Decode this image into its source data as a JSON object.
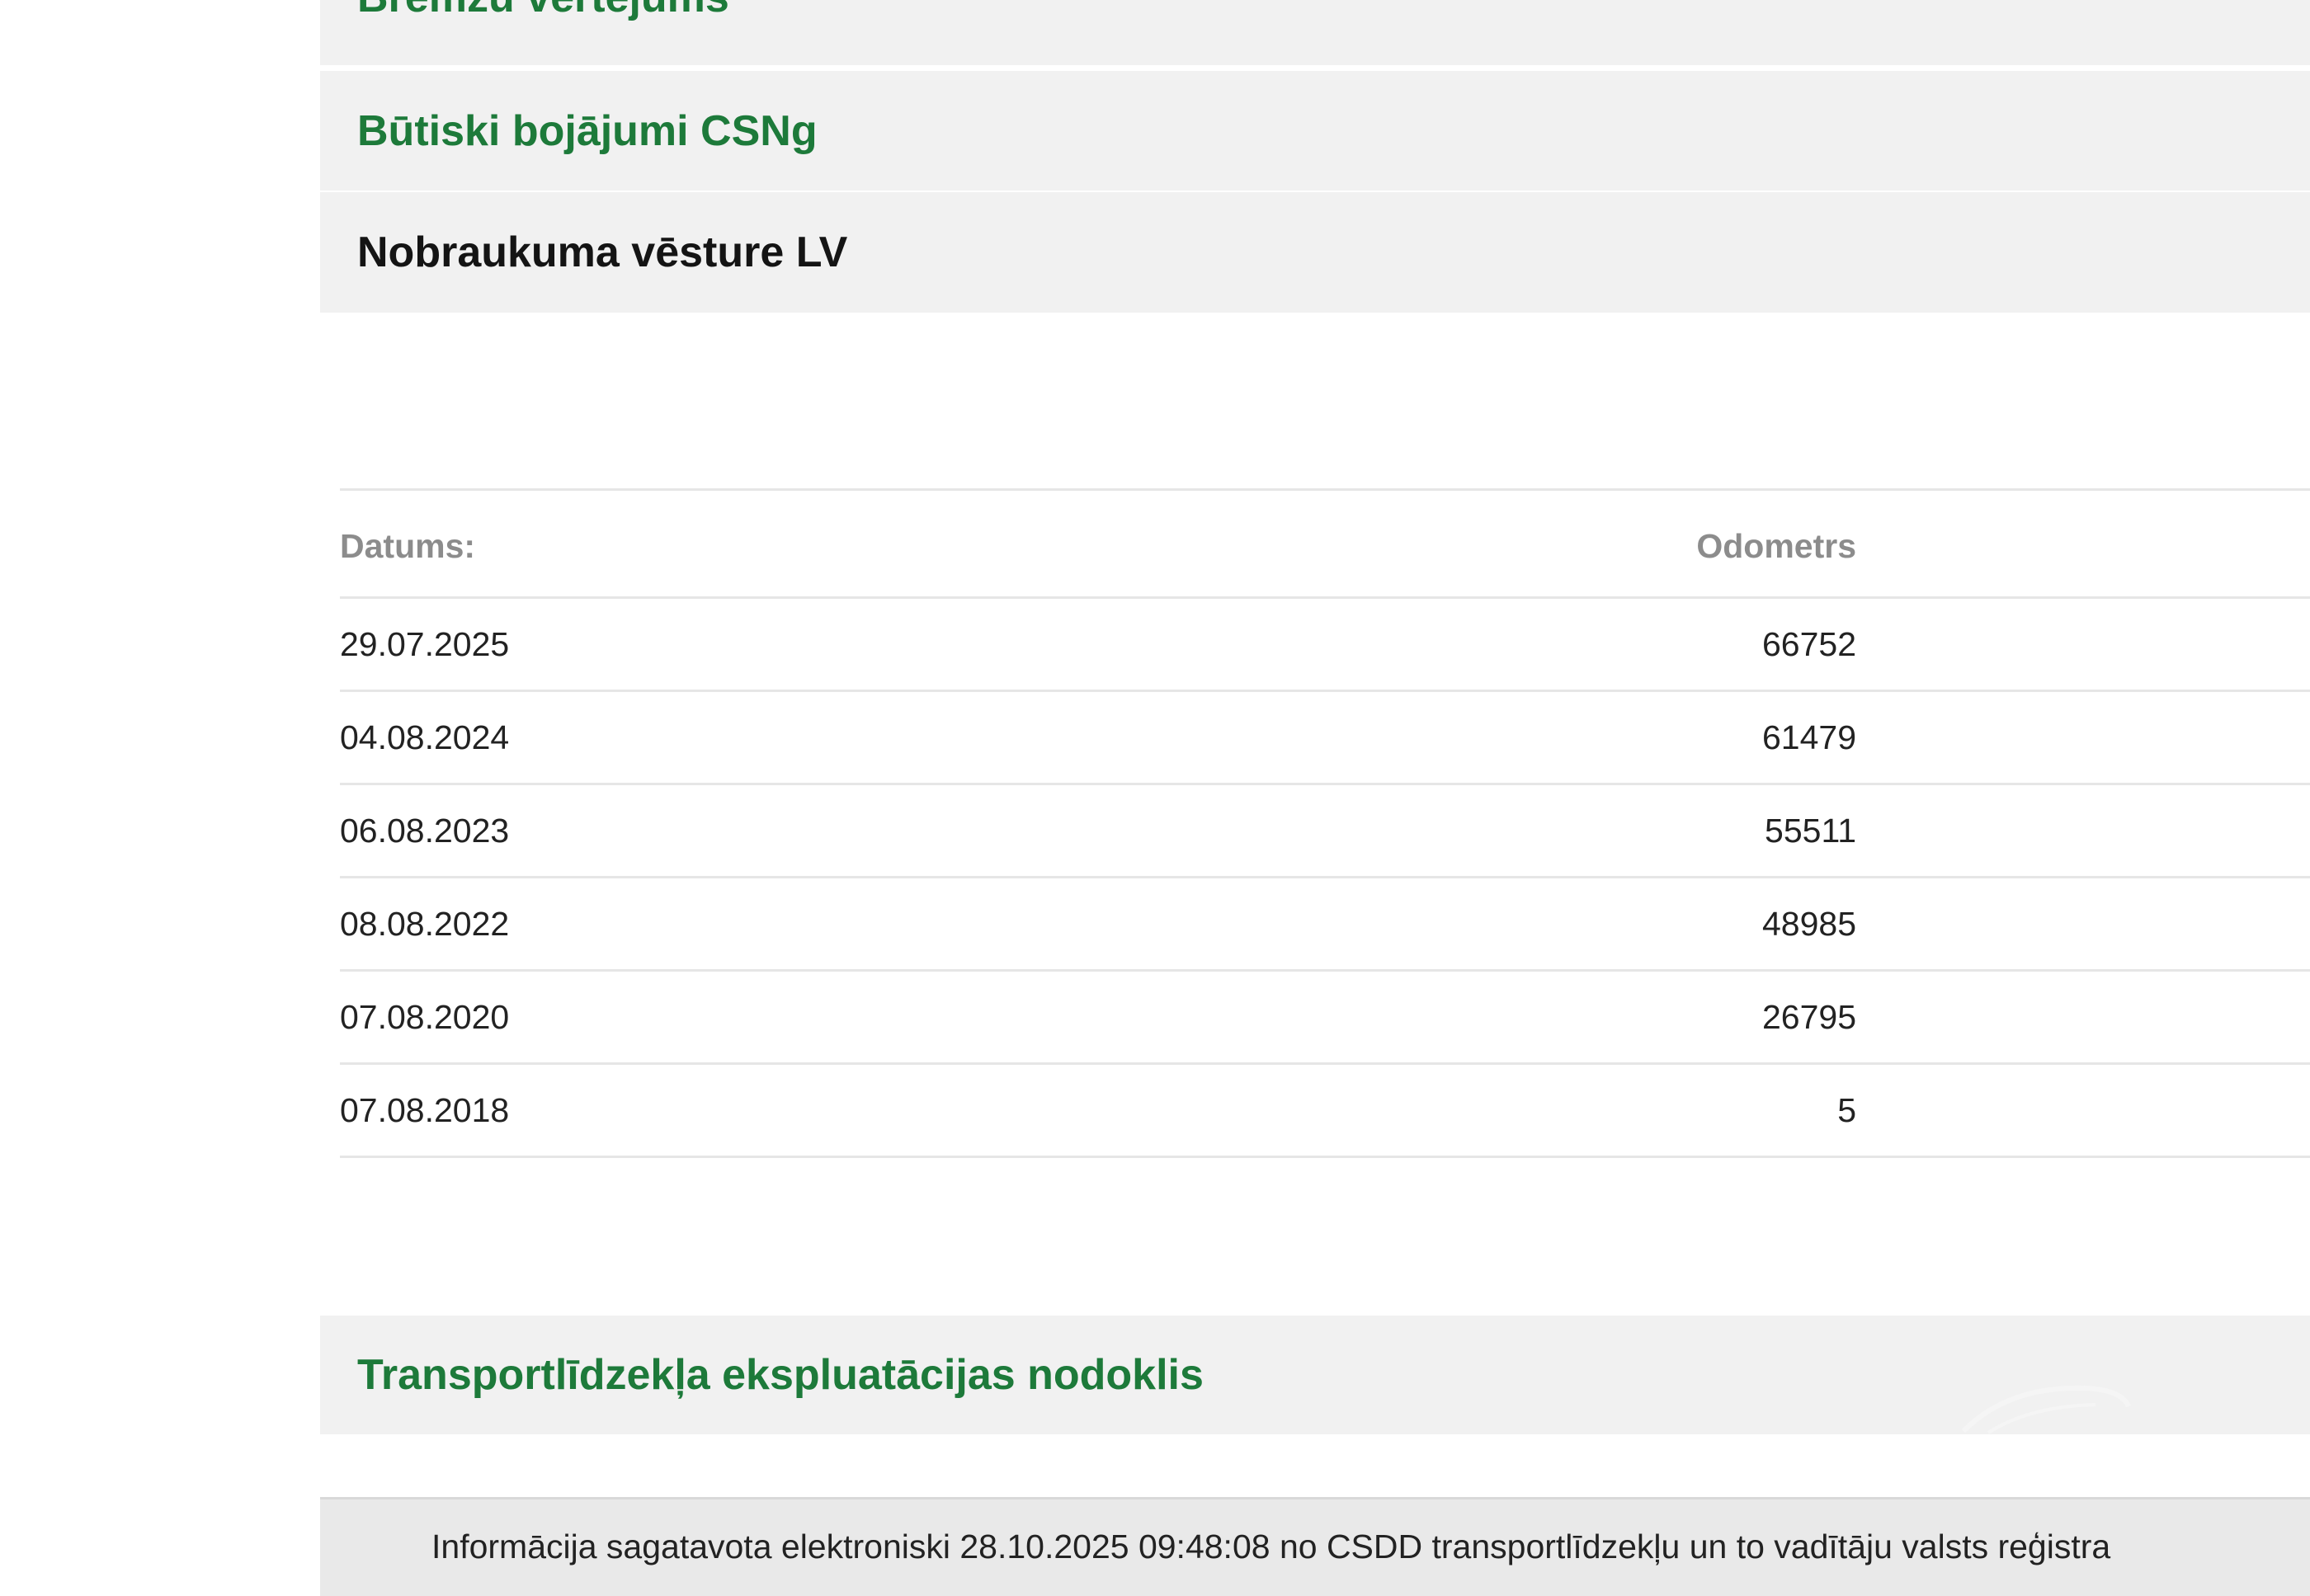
{
  "sections": {
    "bremzu": {
      "label": "Bremzu vērtējums"
    },
    "butiski": {
      "label": "Būtiski bojājumi CSNg"
    },
    "nobraukuma": {
      "label": "Nobraukuma vēsture LV"
    },
    "nodoklis": {
      "label": "Transportlīdzekļa ekspluatācijas nodoklis"
    }
  },
  "mileage_table": {
    "headers": {
      "date": "Datums:",
      "odometer": "Odometrs"
    },
    "rows": [
      {
        "date": "29.07.2025",
        "odometer": "66752"
      },
      {
        "date": "04.08.2024",
        "odometer": "61479"
      },
      {
        "date": "06.08.2023",
        "odometer": "55511"
      },
      {
        "date": "08.08.2022",
        "odometer": "48985"
      },
      {
        "date": "07.08.2020",
        "odometer": "26795"
      },
      {
        "date": "07.08.2018",
        "odometer": "5"
      }
    ]
  },
  "info_box": {
    "text": "Informācija sagatavota elektroniski 28.10.2025 09:48:08 no CSDD transportlīdzekļu un to vadītāju valsts reģistra"
  },
  "colors": {
    "link_green": "#1d7a3a",
    "section_bg": "#f1f1f1",
    "header_grey": "#8c8c8c"
  }
}
